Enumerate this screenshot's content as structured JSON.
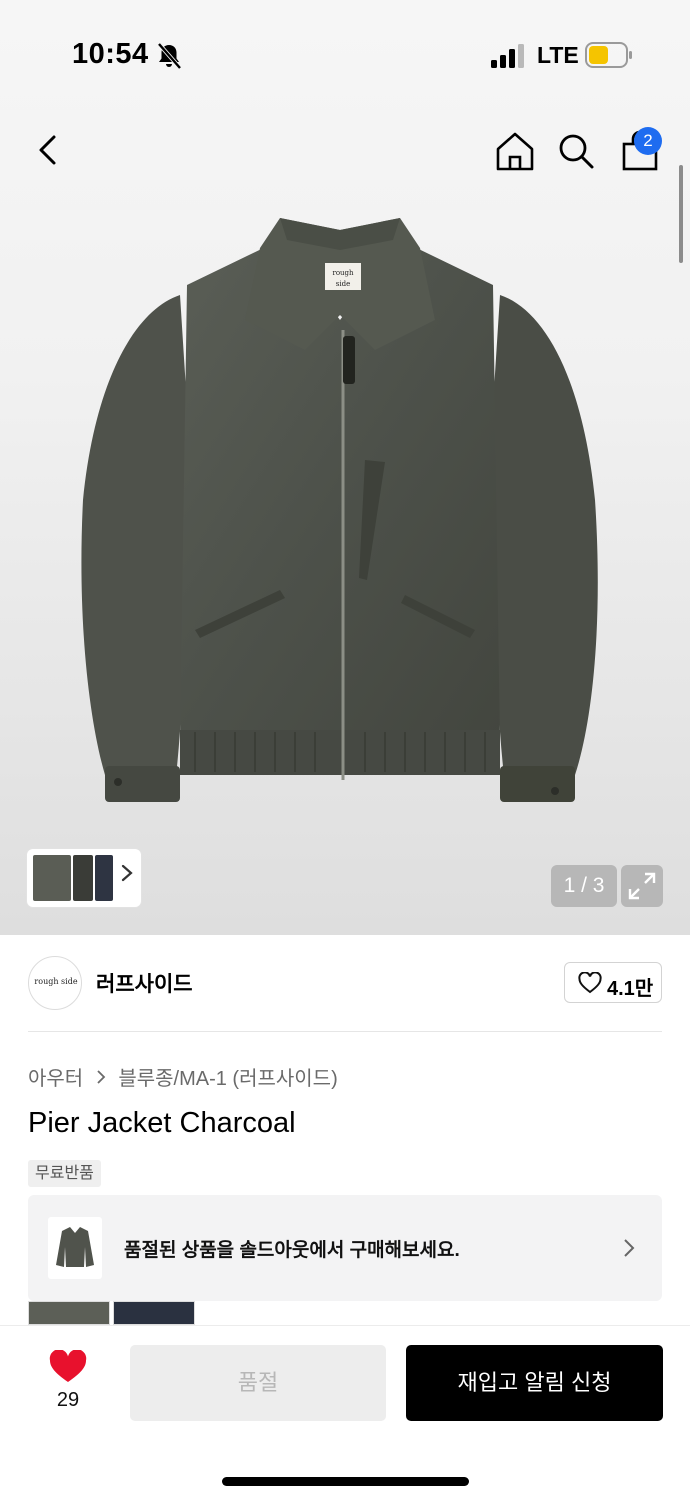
{
  "status_bar": {
    "time": "10:54",
    "network": "LTE"
  },
  "header": {
    "icons": [
      "back-icon",
      "home-icon",
      "search-icon",
      "shopping-bag-icon"
    ],
    "cart_count": "2"
  },
  "gallery": {
    "counter": "1 / 3",
    "image_count": 3,
    "thumbnail_logo": "rough side"
  },
  "brand": {
    "logo_text": "rough side",
    "name": "러프사이드",
    "like_count": "4.1만"
  },
  "product": {
    "breadcrumb": [
      "아우터",
      "블루종/MA-1 (러프사이드)"
    ],
    "title": "Pier Jacket Charcoal",
    "tag": "무료반품"
  },
  "promo": {
    "text": "품절된 상품을 솔드아웃에서 구매해보세요."
  },
  "bottom_bar": {
    "wish_count": "29",
    "soldout_label": "품절",
    "restock_label": "재입고 알림 신청"
  },
  "colors": {
    "accent_badge": "#1e6cf0",
    "heart": "#e8112d",
    "battery": "#f5c400"
  }
}
